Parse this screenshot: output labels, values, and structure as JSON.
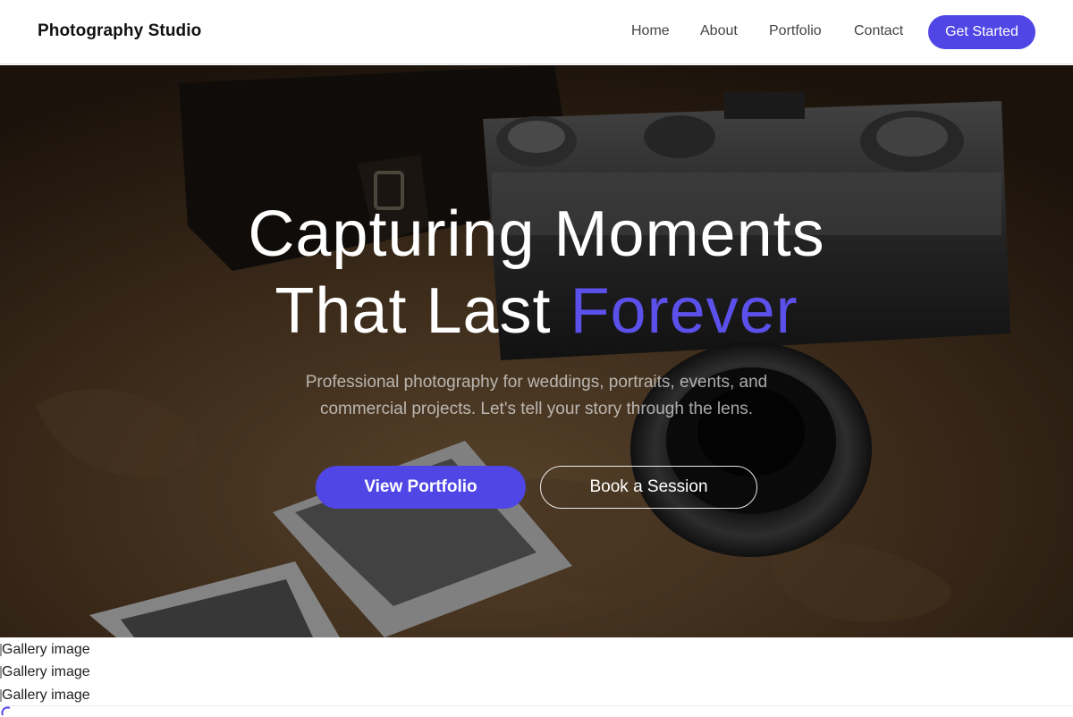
{
  "header": {
    "brand": "Photography Studio",
    "nav": [
      {
        "label": "Home"
      },
      {
        "label": "About"
      },
      {
        "label": "Portfolio"
      },
      {
        "label": "Contact"
      }
    ],
    "cta": "Get Started"
  },
  "hero": {
    "title_line1": "Capturing Moments",
    "title_line2_prefix": "That Last",
    "title_line2_accent": "Forever",
    "subtitle": "Professional photography for weddings, portraits, events, and commercial projects. Let's tell your story through the lens.",
    "primary_button": "View Portfolio",
    "secondary_button": "Book a Session"
  },
  "gallery": {
    "images": [
      {
        "alt": "Gallery image"
      },
      {
        "alt": "Gallery image"
      },
      {
        "alt": "Gallery image"
      }
    ]
  },
  "colors": {
    "accent": "#4f46e5",
    "hero_overlay": "rgba(0,0,0,0.38)"
  }
}
